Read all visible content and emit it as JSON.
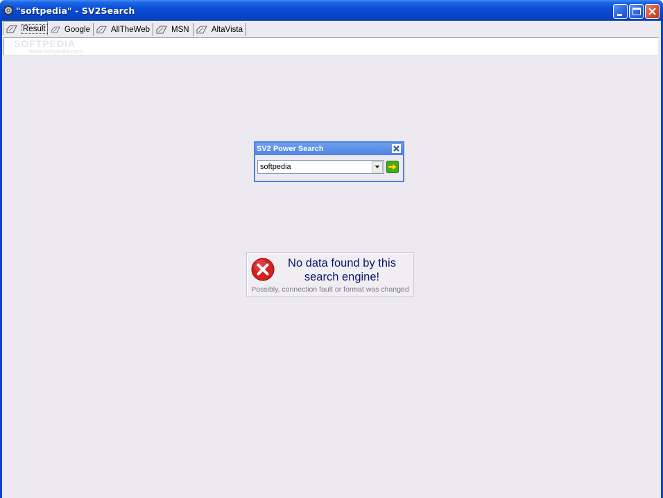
{
  "window": {
    "title": "\"softpedia\" - SV2Search",
    "app_icon": "gear-icon",
    "controls": [
      "minimize-icon",
      "maximize-icon",
      "close-icon"
    ]
  },
  "tabs": [
    {
      "label": "Result",
      "icon": "tag-icon",
      "active": true
    },
    {
      "label": "Google",
      "icon": "tag-icon"
    },
    {
      "label": "AllTheWeb",
      "icon": "tag-icon"
    },
    {
      "label": "MSN",
      "icon": "tag-icon"
    },
    {
      "label": "AltaVista",
      "icon": "tag-icon"
    }
  ],
  "result_bar": {
    "watermark": "SOFTPEDIA",
    "watermark_url": "www.softpedia.com"
  },
  "power_search": {
    "title": "SV2 Power Search",
    "query": "softpedia",
    "go_icon": "arrow-right-icon"
  },
  "error_panel": {
    "icon": "error-x-icon",
    "message": "No data found by this search engine!",
    "detail": "Possibly, connection fault or format was changed"
  },
  "colors": {
    "titlebar": "#0a4fd6",
    "client_bg": "#ece9f0",
    "error_text": "#0c1470",
    "error_icon": "#d42020"
  }
}
